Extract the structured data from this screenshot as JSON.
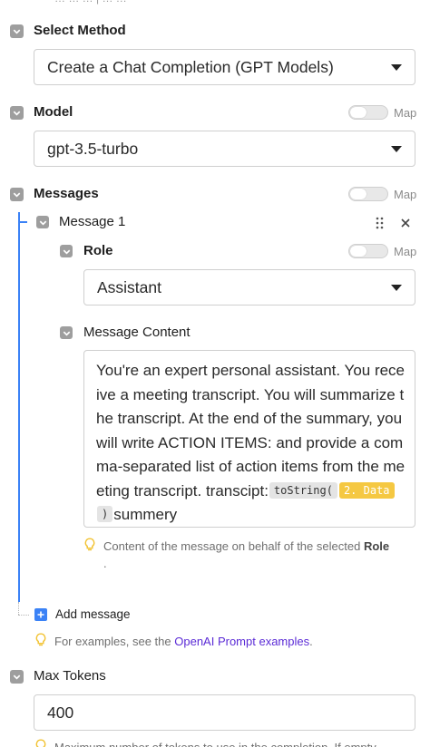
{
  "top_fragment": "…  …  …  |  …  …",
  "select_method": {
    "label": "Select Method",
    "value": "Create a Chat Completion (GPT Models)"
  },
  "model": {
    "label": "Model",
    "map_label": "Map",
    "value": "gpt-3.5-turbo"
  },
  "messages": {
    "label": "Messages",
    "map_label": "Map",
    "message1": {
      "title": "Message 1",
      "role_label": "Role",
      "role_map_label": "Map",
      "role_value": "Assistant",
      "content_label": "Message Content",
      "content_text": "You're an expert personal assistant. You receive a meeting transcript. You will summarize the transcript. At the end of the summary, you will write ACTION ITEMS: and provide a comma-separated list of action items from the meeting transcript. transcipt:",
      "pill_tostring": "toString(",
      "pill_data": "2. Data",
      "pill_close": ")",
      "content_tail": "summery",
      "hint_prefix": "Content of the message on behalf of the selected",
      "hint_bold": "Role",
      "hint_suffix": "."
    },
    "add_message": "Add message",
    "examples_prefix": "For examples, see the",
    "examples_link": "OpenAI Prompt examples",
    "examples_suffix": "."
  },
  "max_tokens": {
    "label": "Max Tokens",
    "value": "400",
    "hint": "Maximum number of tokens to use in the completion. If empty"
  },
  "colors": {
    "accent_blue": "#3b82f6",
    "link_purple": "#5b2bd6",
    "pill_yellow": "#f5c842",
    "checkbox_gray": "#9e9e9e",
    "bulb_yellow": "#f2c230"
  }
}
